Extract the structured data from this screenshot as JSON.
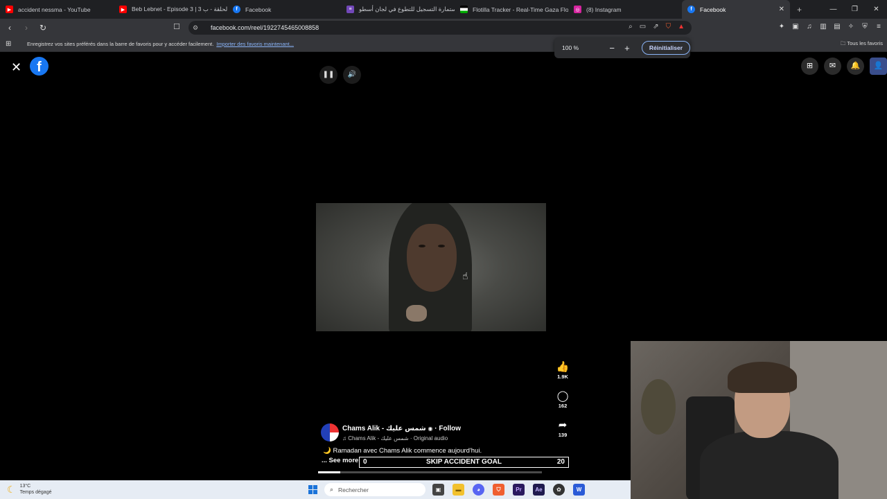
{
  "browser": {
    "tabs": [
      {
        "title": "accident nessma - YouTube",
        "icon": "youtube-icon",
        "color": "#ff0000",
        "active": false
      },
      {
        "title": "Beb Lebnet - Episode 3 | 3 الحلقة - ب",
        "icon": "youtube-icon",
        "color": "#ff0000",
        "active": false
      },
      {
        "title": "Facebook",
        "icon": "facebook-icon",
        "color": "#1877f2",
        "active": false
      },
      {
        "title": "استمارة التسجيل للتطوع في لجان أسطو",
        "icon": "forms-icon",
        "color": "#7248b9",
        "active": false
      },
      {
        "title": "Flotilla Tracker - Real-Time Gaza Flot",
        "icon": "flag-icon",
        "color": "#d33",
        "active": false
      },
      {
        "title": "(8) Instagram",
        "icon": "instagram-icon",
        "color": "#d6249f",
        "active": false
      },
      {
        "title": "Facebook",
        "icon": "facebook-icon",
        "color": "#1877f2",
        "active": true
      }
    ],
    "url": "facebook.com/reel/1922745465008858",
    "bookmark_bar": {
      "message": "Enregistrez vos sites préférés dans la barre de favoris pour y accéder facilement.",
      "link": "Importer des favoris maintenant...",
      "all_favorites": "Tous les favoris"
    },
    "zoom": {
      "level": "100 %",
      "minus": "−",
      "plus": "+",
      "reset": "Réinitialiser"
    }
  },
  "reel": {
    "author": "Chams Alik - شمس عليك",
    "follow": "· Follow",
    "audio": "♫ Chams Alik - شمس عليك · Original audio",
    "caption": "🌙 Ramadan avec Chams Alik commence aujourd'hui.",
    "see_more": "... See more",
    "likes": "1.9K",
    "comments": "162",
    "shares": "139",
    "progress": 0.1
  },
  "overlay": {
    "goal_left": "0",
    "goal_label": "SKIP ACCIDENT GOAL",
    "goal_right": "20"
  },
  "taskbar": {
    "temperature": "13°C",
    "weather": "Temps dégagé",
    "search": "Rechercher"
  },
  "colors": {
    "facebook_blue": "#1877f2",
    "accent_link": "#8ab4f8"
  }
}
